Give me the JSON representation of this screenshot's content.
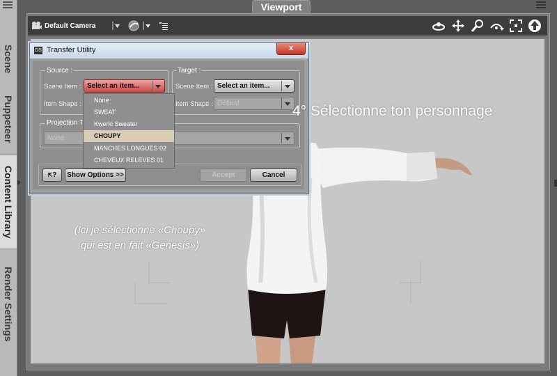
{
  "left_tabs": {
    "items": [
      {
        "label": "Scene",
        "active": false
      },
      {
        "label": "Puppeteer",
        "active": false
      },
      {
        "label": "Content Library",
        "active": true
      },
      {
        "label": "Render Settings",
        "active": false
      }
    ]
  },
  "viewport": {
    "tab_label": "Viewport",
    "toolbar": {
      "camera_label": "Default Camera",
      "icons": [
        "camera-icon",
        "dropdown-arrow-icon",
        "shading-sphere-icon",
        "dropdown-arrow-icon",
        "menu-lines-icon",
        "orbit-icon",
        "pan-icon",
        "zoom-icon",
        "rotate-icon",
        "frame-icon",
        "up-arrow-icon"
      ]
    }
  },
  "dialog": {
    "title": "Transfer Utility",
    "close_label": "x",
    "source": {
      "group_label": "Source :",
      "scene_item_label": "Scene Item :",
      "scene_item_value": "Select an item...",
      "item_shape_label": "Item Shape :"
    },
    "target": {
      "group_label": "Target :",
      "scene_item_label": "Scene Item :",
      "scene_item_value": "Select an item...",
      "item_shape_label": "Item Shape :",
      "item_shape_value": "Default"
    },
    "projection": {
      "group_label": "Projection Te",
      "value": "None"
    },
    "help_label": "?",
    "show_options_label": "Show Options >>",
    "accept_label": "Accept",
    "cancel_label": "Cancel",
    "dropdown_items": [
      {
        "label": "None",
        "selected": false
      },
      {
        "label": "SWEAT",
        "selected": false
      },
      {
        "label": "Kwerki Sweater",
        "selected": false
      },
      {
        "label": "CHOUPY",
        "selected": true
      },
      {
        "label": "MANCHES LONGUES 02",
        "selected": false
      },
      {
        "label": "CHEVEUX RELEVES 01",
        "selected": false
      }
    ]
  },
  "annotations": {
    "step": "4°   Sélectionne ton personnage",
    "note_line1": "(Ici je sélectionne «Choupy»",
    "note_line2": "qui est en fait «Genesis»)"
  },
  "colors": {
    "toolbar_bg": "#3d3d3d",
    "scene_bg": "#c7c7c7",
    "dialog_bg": "#8e8e8e",
    "highlight_combo": "#c94a4a",
    "selected_item_bg": "#d9ccb5"
  }
}
